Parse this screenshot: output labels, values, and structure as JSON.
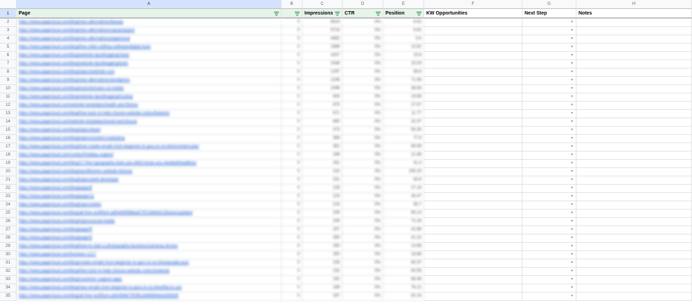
{
  "columns": [
    "A",
    "B",
    "C",
    "D",
    "E",
    "F",
    "G",
    "H"
  ],
  "headers": {
    "page": "Page",
    "b": "",
    "impressions": "Impressions",
    "ctr": "CTR",
    "position": "Position",
    "kw": "KW Opportunities",
    "next": "Next Step",
    "notes": "Notes"
  },
  "rows": [
    {
      "n": "2",
      "url": "https://www.pagecloud.com/blog/new-alternatives/beauty",
      "b": "0",
      "imp": "6616",
      "ctr": "0%",
      "pos": "6.52"
    },
    {
      "n": "3",
      "url": "https://www.pagecloud.com/blog/new-alternatives/squarespace",
      "b": "0",
      "imp": "5724",
      "ctr": "0%",
      "pos": "6.62"
    },
    {
      "n": "4",
      "url": "https://www.pagecloud.com/blog/new-alternatives/pagecloud",
      "b": "0",
      "imp": "4482",
      "ctr": "0%",
      "pos": "5.6"
    },
    {
      "n": "5",
      "url": "https://www.pagecloud.com/blog/free-video-editing-software/digital-tools",
      "b": "0",
      "imp": "1988",
      "ctr": "0%",
      "pos": "13.62"
    },
    {
      "n": "6",
      "url": "https://www.pagecloud.com/blog/website-tips/blogging/clean",
      "b": "0",
      "imp": "1637",
      "ctr": "0%",
      "pos": "15.6"
    },
    {
      "n": "7",
      "url": "https://www.pagecloud.com/blog/website-tips/blogging/tools",
      "b": "0",
      "imp": "1548",
      "ctr": "0%",
      "pos": "15.03"
    },
    {
      "n": "8",
      "url": "https://www.pagecloud.com/blog/topics/website-cost",
      "b": "0",
      "imp": "1297",
      "ctr": "0%",
      "pos": "58.8"
    },
    {
      "n": "9",
      "url": "https://www.pagecloud.com/blog/new-alternatives/wordpress",
      "b": "0",
      "imp": "1236",
      "ctr": "0%",
      "pos": "71.56"
    },
    {
      "n": "10",
      "url": "https://www.pagecloud.com/blog/tools/domains-on-holder",
      "b": "0",
      "imp": "1096",
      "ctr": "0%",
      "pos": "38.94"
    },
    {
      "n": "11",
      "url": "https://www.pagecloud.com/blog/website-tips/blogging/hosting",
      "b": "0",
      "imp": "940",
      "ctr": "0%",
      "pos": "19.69"
    },
    {
      "n": "12",
      "url": "https://www.pagecloud.com/website-templates/health-and-fitness",
      "b": "0",
      "imp": "875",
      "ctr": "0%",
      "pos": "27.57"
    },
    {
      "n": "13",
      "url": "https://www.pagecloud.com/blog/free-tools-to-help-choose-website-colors/features",
      "b": "0",
      "imp": "671",
      "ctr": "0%",
      "pos": "11.77"
    },
    {
      "n": "14",
      "url": "https://www.pagecloud.com/website-templates/travel-and-leisure",
      "b": "0",
      "imp": "660",
      "ctr": "0%",
      "pos": "32.37"
    },
    {
      "n": "15",
      "url": "https://www.pagecloud.com/blog/topics/team",
      "b": "0",
      "imp": "373",
      "ctr": "0%",
      "pos": "65.35"
    },
    {
      "n": "16",
      "url": "https://www.pagecloud.com/blog/topics/content-marketing",
      "b": "0",
      "imp": "369",
      "ctr": "0%",
      "pos": "77.6"
    },
    {
      "n": "17",
      "url": "https://www.pagecloud.com/blog/how-create-emails-from-beginner-to-guru-in-no-time/content-plan",
      "b": "0",
      "imp": "361",
      "ctr": "0%",
      "pos": "69.08"
    },
    {
      "n": "18",
      "url": "https://www.pagecloud.com/contact/holiday-support",
      "b": "0",
      "imp": "299",
      "ctr": "0%",
      "pos": "21.68"
    },
    {
      "n": "19",
      "url": "https://www.pagecloud.com/blog/17-free-typography-tools-you-didnt-know-you-needed/headlines",
      "b": "0",
      "imp": "261",
      "ctr": "0%",
      "pos": "41.4"
    },
    {
      "n": "20",
      "url": "https://www.pagecloud.com/blog/wordthemes-website-themes",
      "b": "0",
      "imp": "232",
      "ctr": "0%",
      "pos": "155.23"
    },
    {
      "n": "21",
      "url": "https://www.pagecloud.com/blog/topics/web-developer",
      "b": "0",
      "imp": "231",
      "ctr": "0%",
      "pos": "63.8"
    },
    {
      "n": "22",
      "url": "https://www.pagecloud.com/blog/page/6",
      "b": "0",
      "imp": "229",
      "ctr": "0%",
      "pos": "27.19"
    },
    {
      "n": "23",
      "url": "https://www.pagecloud.com/blog/page/11",
      "b": "0",
      "imp": "219",
      "ctr": "0%",
      "pos": "26.47"
    },
    {
      "n": "24",
      "url": "https://www.pagecloud.com/blog/topics/video",
      "b": "0",
      "imp": "215",
      "ctr": "0%",
      "pos": "65.7"
    },
    {
      "n": "25",
      "url": "https://www.pagecloud.com/blog/all-free-stuff/text-ad0e9d998bba5797e3fd4ef13fa2ee/updated",
      "b": "0",
      "imp": "205",
      "ctr": "0%",
      "pos": "65.13"
    },
    {
      "n": "26",
      "url": "https://www.pagecloud.com/blog/topics/social-media",
      "b": "0",
      "imp": "206",
      "ctr": "0%",
      "pos": "72.26"
    },
    {
      "n": "27",
      "url": "https://www.pagecloud.com/blog/page/9",
      "b": "0",
      "imp": "257",
      "ctr": "0%",
      "pos": "42.86"
    },
    {
      "n": "28",
      "url": "https://www.pagecloud.com/blog/page/5",
      "b": "0",
      "imp": "250",
      "ctr": "0%",
      "pos": "41.32"
    },
    {
      "n": "29",
      "url": "https://www.pagecloud.com/blog/how-to-start-a-photography-business/cameras-lenses",
      "b": "0",
      "imp": "250",
      "ctr": "0%",
      "pos": "13.68"
    },
    {
      "n": "30",
      "url": "https://www.pagecloud.com/fourteen-1217",
      "b": "0",
      "imp": "250",
      "ctr": "0%",
      "pos": "16.86"
    },
    {
      "n": "31",
      "url": "https://www.pagecloud.com/blog/create-emails-from-beginner-to-guru-in-no-time/google-post",
      "b": "0",
      "imp": "235",
      "ctr": "0%",
      "pos": "65.37"
    },
    {
      "n": "32",
      "url": "https://www.pagecloud.com/blog/free-tools-to-help-choose-website-colors/material",
      "b": "0",
      "imp": "232",
      "ctr": "0%",
      "pos": "83.55"
    },
    {
      "n": "33",
      "url": "https://www.pagecloud.com/blog/customer-support-apps",
      "b": "0",
      "imp": "192",
      "ctr": "0%",
      "pos": "68.46"
    },
    {
      "n": "34",
      "url": "https://www.pagecloud.com/blog/new-emails-from-beginner-to-guru-in-no-time/flat-to-use",
      "b": "0",
      "imp": "189",
      "ctr": "0%",
      "pos": "76.12"
    },
    {
      "n": "35",
      "url": "https://www.pagecloud.com/blog/all-free-stuff/text-ad0d3b9e79095cd4686f4dee0d0b09",
      "b": "0",
      "imp": "187",
      "ctr": "0%",
      "pos": "82.16"
    }
  ],
  "colors": {
    "header_sel": "#d3e3fd",
    "title_hl": "#e6f4ea",
    "link": "#1a5ad7"
  }
}
